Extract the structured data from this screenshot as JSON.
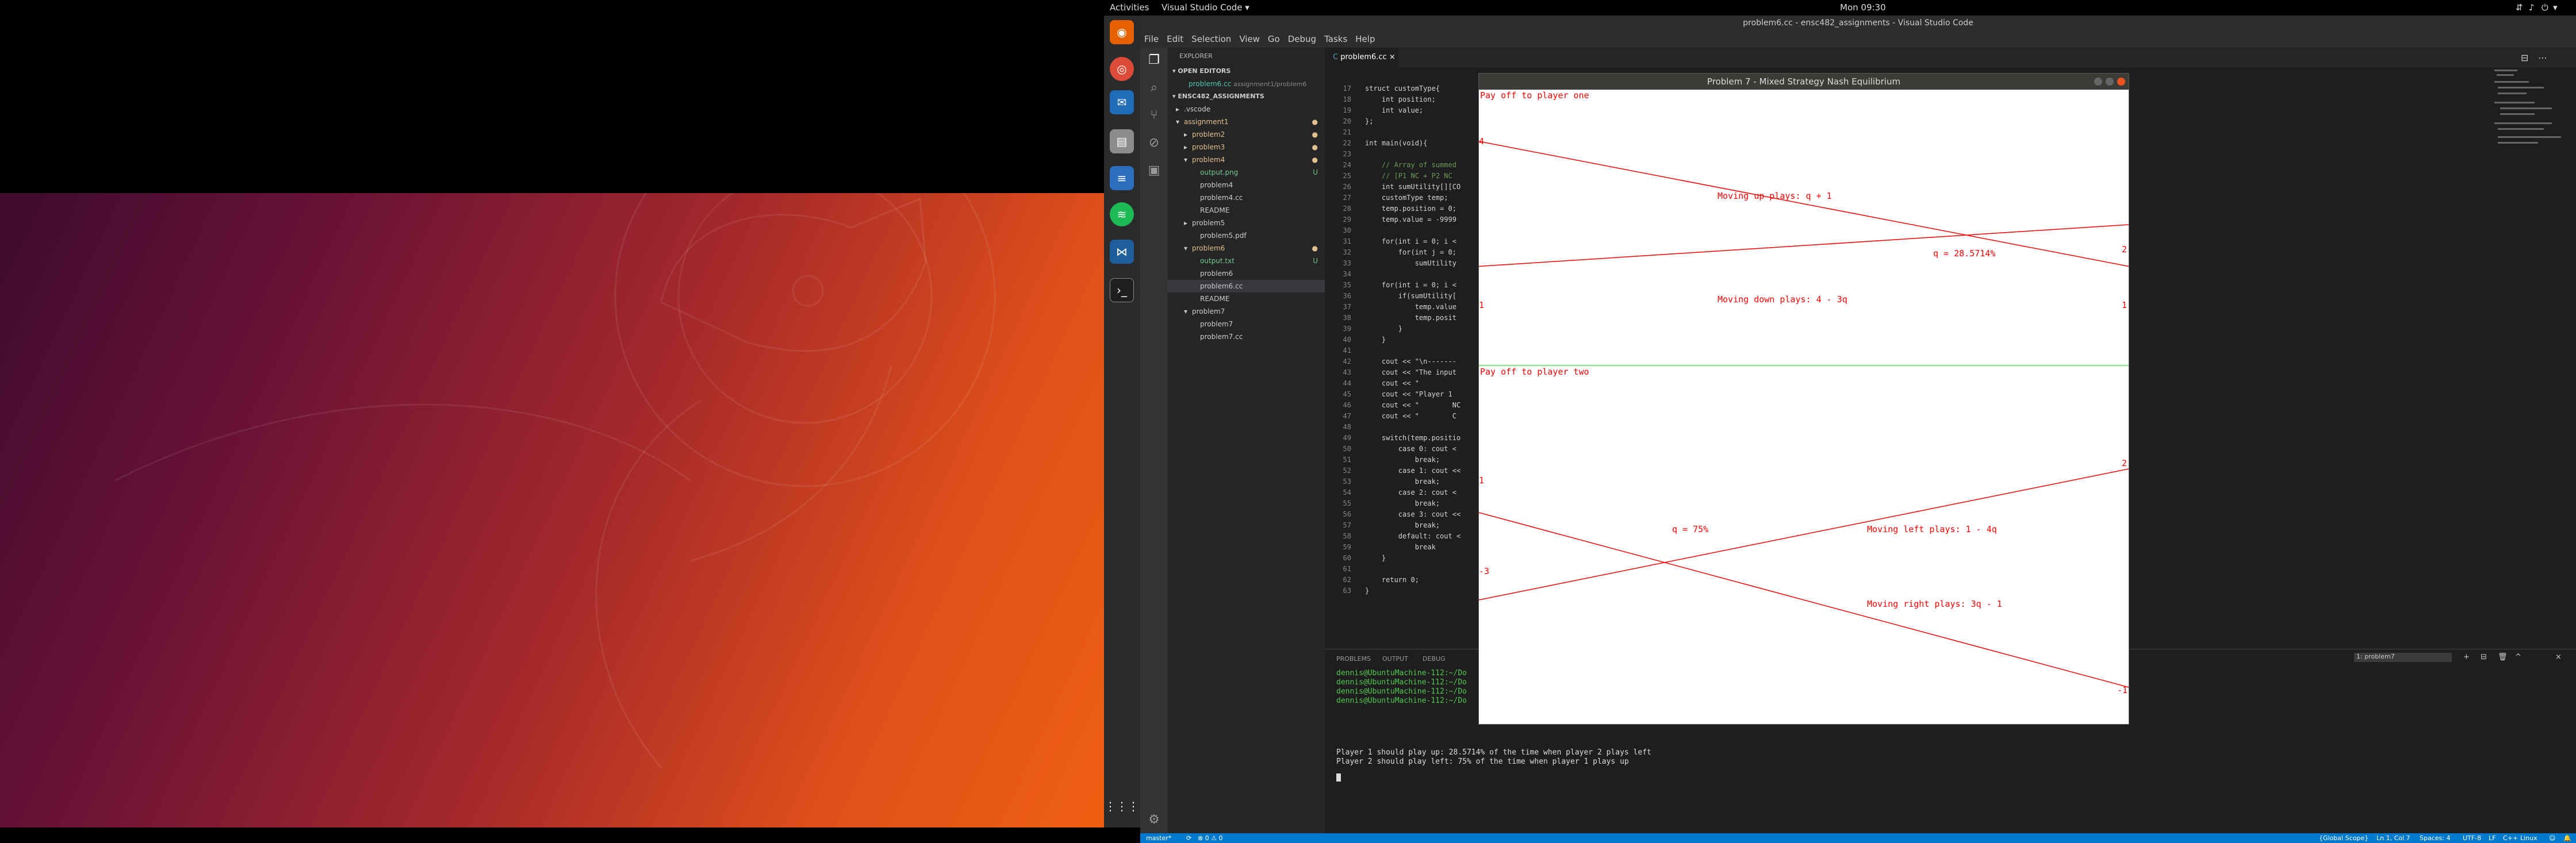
{
  "topbar": {
    "activities": "Activities",
    "app_menu": "Visual Studio Code ▾",
    "clock": "Mon 09:30"
  },
  "window": {
    "title": "problem6.cc - ensc482_assignments - Visual Studio Code"
  },
  "menu": [
    "File",
    "Edit",
    "Selection",
    "View",
    "Go",
    "Debug",
    "Tasks",
    "Help"
  ],
  "explorer": {
    "header": "EXPLORER",
    "open_editors": "OPEN EDITORS",
    "open_file": "problem6.cc",
    "open_file_path": "assignment1/problem6",
    "workspace": "ENSC482_ASSIGNMENTS",
    "items": [
      {
        "label": ".vscode",
        "indent": 1,
        "arrow": "▸",
        "mark": ""
      },
      {
        "label": "assignment1",
        "indent": 1,
        "arrow": "▾",
        "mark": "●"
      },
      {
        "label": "problem2",
        "indent": 2,
        "arrow": "▸",
        "mark": "●"
      },
      {
        "label": "problem3",
        "indent": 2,
        "arrow": "▸",
        "mark": "●"
      },
      {
        "label": "problem4",
        "indent": 2,
        "arrow": "▾",
        "mark": "●"
      },
      {
        "label": "output.png",
        "indent": 3,
        "arrow": "",
        "mark": "U"
      },
      {
        "label": "problem4",
        "indent": 3,
        "arrow": "",
        "mark": ""
      },
      {
        "label": "problem4.cc",
        "indent": 3,
        "arrow": "",
        "mark": ""
      },
      {
        "label": "README",
        "indent": 3,
        "arrow": "",
        "mark": ""
      },
      {
        "label": "problem5",
        "indent": 2,
        "arrow": "▸",
        "mark": ""
      },
      {
        "label": "problem5.pdf",
        "indent": 3,
        "arrow": "",
        "mark": ""
      },
      {
        "label": "problem6",
        "indent": 2,
        "arrow": "▾",
        "mark": "●"
      },
      {
        "label": "output.txt",
        "indent": 3,
        "arrow": "",
        "mark": "U"
      },
      {
        "label": "problem6",
        "indent": 3,
        "arrow": "",
        "mark": ""
      },
      {
        "label": "problem6.cc",
        "indent": 3,
        "arrow": "",
        "mark": ""
      },
      {
        "label": "README",
        "indent": 3,
        "arrow": "",
        "mark": ""
      },
      {
        "label": "problem7",
        "indent": 2,
        "arrow": "▾",
        "mark": ""
      },
      {
        "label": "problem7",
        "indent": 3,
        "arrow": "",
        "mark": ""
      },
      {
        "label": "problem7.cc",
        "indent": 3,
        "arrow": "",
        "mark": ""
      }
    ]
  },
  "tab": {
    "label": "problem6.cc"
  },
  "code": [
    {
      "n": "17",
      "t": "struct customType{"
    },
    {
      "n": "18",
      "t": "    int position;"
    },
    {
      "n": "19",
      "t": "    int value;"
    },
    {
      "n": "20",
      "t": "};"
    },
    {
      "n": "21",
      "t": ""
    },
    {
      "n": "22",
      "t": "int main(void){"
    },
    {
      "n": "23",
      "t": ""
    },
    {
      "n": "24",
      "t": "    // Array of summed"
    },
    {
      "n": "25",
      "t": "    // [P1 NC + P2 NC"
    },
    {
      "n": "26",
      "t": "    int sumUtility[][CO"
    },
    {
      "n": "27",
      "t": "    customType temp;"
    },
    {
      "n": "28",
      "t": "    temp.position = 0;"
    },
    {
      "n": "29",
      "t": "    temp.value = -9999"
    },
    {
      "n": "30",
      "t": ""
    },
    {
      "n": "31",
      "t": "    for(int i = 0; i <"
    },
    {
      "n": "32",
      "t": "        for(int j = 0;"
    },
    {
      "n": "33",
      "t": "            sumUtility"
    },
    {
      "n": "34",
      "t": ""
    },
    {
      "n": "35",
      "t": "    for(int i = 0; i <"
    },
    {
      "n": "36",
      "t": "        if(sumUtility["
    },
    {
      "n": "37",
      "t": "            temp.value"
    },
    {
      "n": "38",
      "t": "            temp.posit"
    },
    {
      "n": "39",
      "t": "        }"
    },
    {
      "n": "40",
      "t": "    }"
    },
    {
      "n": "41",
      "t": ""
    },
    {
      "n": "42",
      "t": "    cout << \"\\n-------"
    },
    {
      "n": "43",
      "t": "    cout << \"The input"
    },
    {
      "n": "44",
      "t": "    cout << \""
    },
    {
      "n": "45",
      "t": "    cout << \"Player 1"
    },
    {
      "n": "46",
      "t": "    cout << \"        NC"
    },
    {
      "n": "47",
      "t": "    cout << \"        C"
    },
    {
      "n": "48",
      "t": ""
    },
    {
      "n": "49",
      "t": "    switch(temp.positio"
    },
    {
      "n": "50",
      "t": "        case 0: cout <"
    },
    {
      "n": "51",
      "t": "            break;"
    },
    {
      "n": "52",
      "t": "        case 1: cout <<"
    },
    {
      "n": "53",
      "t": "            break;"
    },
    {
      "n": "54",
      "t": "        case 2: cout <"
    },
    {
      "n": "55",
      "t": "            break;"
    },
    {
      "n": "56",
      "t": "        case 3: cout <<"
    },
    {
      "n": "57",
      "t": "            break;"
    },
    {
      "n": "58",
      "t": "        default: cout <"
    },
    {
      "n": "59",
      "t": "            break"
    },
    {
      "n": "60",
      "t": "    }"
    },
    {
      "n": "61",
      "t": ""
    },
    {
      "n": "62",
      "t": "    return 0;"
    },
    {
      "n": "63",
      "t": "}"
    }
  ],
  "panel": {
    "tabs": [
      "PROBLEMS",
      "OUTPUT",
      "DEBUG"
    ],
    "terminal_select": "1: problem7",
    "prompts": [
      "dennis@UbuntuMachine-112:~/Do",
      "dennis@UbuntuMachine-112:~/Do",
      "dennis@UbuntuMachine-112:~/Do",
      "dennis@UbuntuMachine-112:~/Do"
    ],
    "out1": "Player 1 should play up: 28.5714% of the time when player 2 plays left",
    "out2": "Player 2 should play left: 75% of the time when player 1 plays up"
  },
  "status": {
    "branch": "master*",
    "sync": "⟳",
    "problems": "⊗ 0  ⚠ 0",
    "scope": "{Global Scope}",
    "pos": "Ln 1, Col 7",
    "spaces": "Spaces: 4",
    "enc": "UTF-8",
    "eol": "LF",
    "lang": "C++",
    "os": "Linux"
  },
  "plot": {
    "title": "Problem 7 - Mixed Strategy Nash Equilibrium",
    "p1_label": "Pay off to player one",
    "p1_up": "Moving up plays: q + 1",
    "p1_down": "Moving down plays: 4 - 3q",
    "p1_q": "q = 28.5714%",
    "p1_lt": "4",
    "p1_lb": "1",
    "p1_rt": "2",
    "p1_rb": "1",
    "p2_label": "Pay off to player two",
    "p2_q": "q = 75%",
    "p2_left": "Moving left plays: 1 - 4q",
    "p2_right": "Moving right plays: 3q - 1",
    "p2_lt": "1",
    "p2_lb": "-3",
    "p2_rt": "2",
    "p2_rb": "-1",
    "line_color": "#ff0000"
  },
  "chart_data": [
    {
      "type": "line",
      "title": "Pay off to player one",
      "series": [
        {
          "name": "Moving up plays: q + 1",
          "x": [
            0,
            1
          ],
          "y": [
            1,
            2
          ]
        },
        {
          "name": "Moving down plays: 4 - 3q",
          "x": [
            0,
            1
          ],
          "y": [
            4,
            1
          ]
        }
      ],
      "annotation": "q = 28.5714%"
    },
    {
      "type": "line",
      "title": "Pay off to player two",
      "series": [
        {
          "name": "Moving left plays: 1 - 4q",
          "x": [
            0,
            1
          ],
          "y": [
            1,
            -3
          ]
        },
        {
          "name": "Moving right plays: 3q - 1",
          "x": [
            0,
            1
          ],
          "y": [
            -1,
            2
          ]
        }
      ],
      "annotation": "q = 75%"
    }
  ]
}
